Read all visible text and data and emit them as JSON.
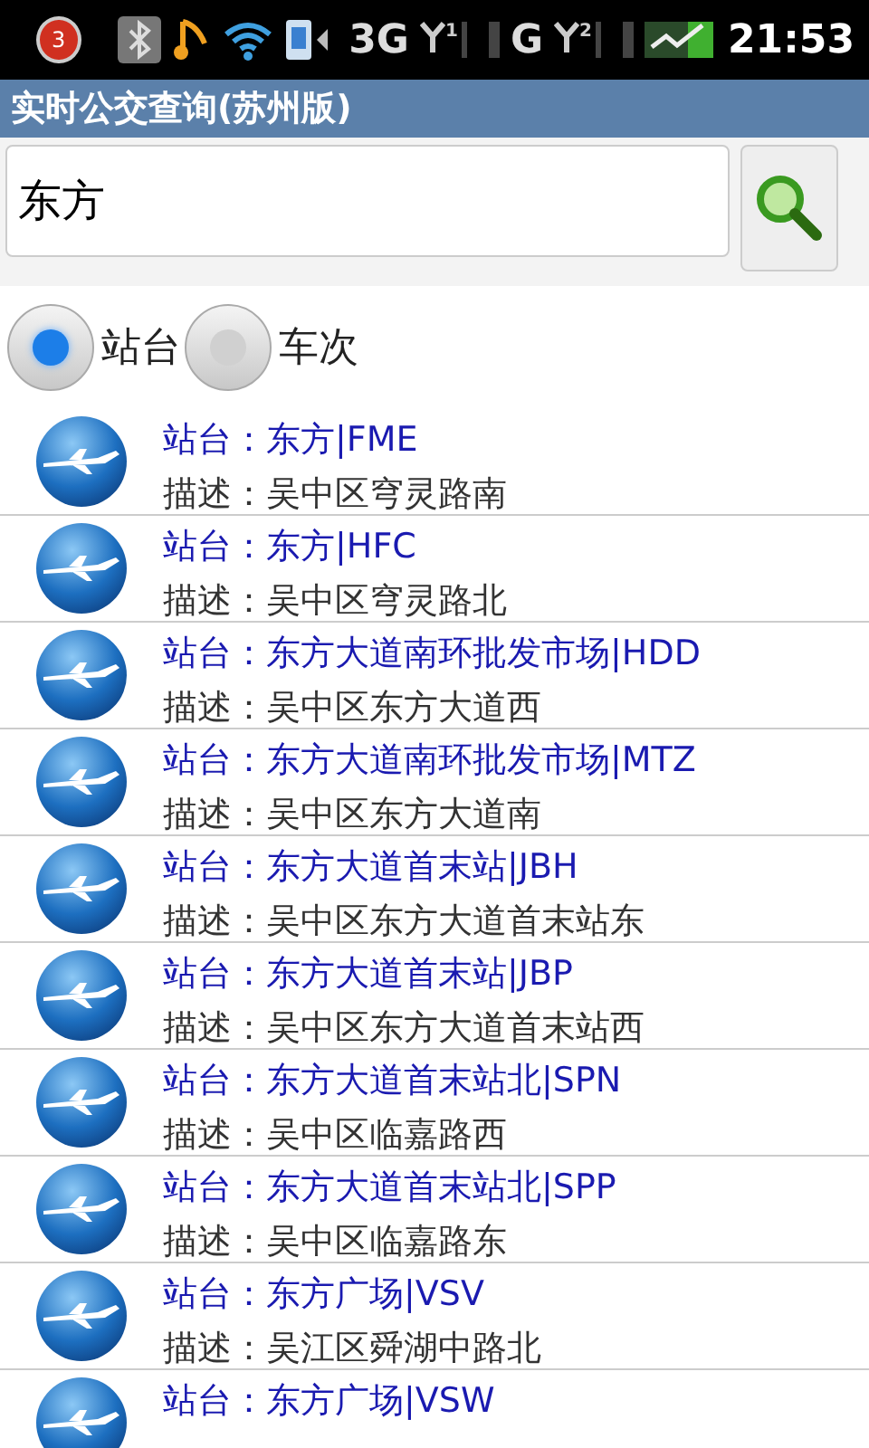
{
  "status_bar": {
    "notification_count": "3",
    "network_1": "3G",
    "sim_1": "1",
    "network_2": "G",
    "sim_2": "2",
    "time": "21:53"
  },
  "app_title": "实时公交查询(苏州版)",
  "search": {
    "value": "东方"
  },
  "modes": [
    {
      "label": "站台",
      "selected": true
    },
    {
      "label": "车次",
      "selected": false
    }
  ],
  "results": [
    {
      "station": "站台：东方|FME",
      "description": "描述：吴中区穹灵路南"
    },
    {
      "station": "站台：东方|HFC",
      "description": "描述：吴中区穹灵路北"
    },
    {
      "station": "站台：东方大道南环批发市场|HDD",
      "description": "描述：吴中区东方大道西"
    },
    {
      "station": "站台：东方大道南环批发市场|MTZ",
      "description": "描述：吴中区东方大道南"
    },
    {
      "station": "站台：东方大道首末站|JBH",
      "description": "描述：吴中区东方大道首末站东"
    },
    {
      "station": "站台：东方大道首末站|JBP",
      "description": "描述：吴中区东方大道首末站西"
    },
    {
      "station": "站台：东方大道首末站北|SPN",
      "description": "描述：吴中区临嘉路西"
    },
    {
      "station": "站台：东方大道首末站北|SPP",
      "description": "描述：吴中区临嘉路东"
    },
    {
      "station": "站台：东方广场|VSV",
      "description": "描述：吴江区舜湖中路北"
    },
    {
      "station": "站台：东方广场|VSW"
    }
  ]
}
